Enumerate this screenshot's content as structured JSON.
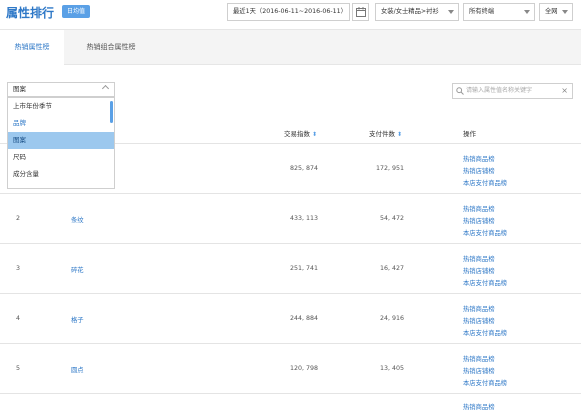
{
  "header": {
    "title": "属性排行",
    "badge": "日均值",
    "date_range": "最近1天（2016-06-11~2016-06-11）",
    "category": "女装/女士精品>衬衫",
    "terminal": "所有终端",
    "scope": "全网"
  },
  "tabs": [
    {
      "label": "热销属性榜",
      "active": true
    },
    {
      "label": "热销组合属性榜",
      "active": false
    }
  ],
  "filter": {
    "selected": "图案",
    "options": [
      "上市年份季节",
      "品牌",
      "图案",
      "尺码",
      "成分含量"
    ]
  },
  "search": {
    "placeholder": "请输入属性值名称关键字"
  },
  "table": {
    "headers": {
      "trade_index": "交易指数",
      "pay_count": "支付件数",
      "action": "操作"
    },
    "action_links": [
      "热销商品榜",
      "热销店铺榜",
      "本店支付商品榜"
    ],
    "rows": [
      {
        "rank": "",
        "name": "",
        "trade_index": "825, 874",
        "pay_count": "172, 951"
      },
      {
        "rank": "2",
        "name": "条纹",
        "trade_index": "433, 113",
        "pay_count": "54, 472"
      },
      {
        "rank": "3",
        "name": "碎花",
        "trade_index": "251, 741",
        "pay_count": "16, 427"
      },
      {
        "rank": "4",
        "name": "格子",
        "trade_index": "244, 884",
        "pay_count": "24, 916"
      },
      {
        "rank": "5",
        "name": "圆点",
        "trade_index": "120, 798",
        "pay_count": "13, 405"
      }
    ],
    "partial_row_action": "热销商品榜"
  },
  "colors": {
    "accent": "#2e78c7",
    "badge": "#5aa0e6",
    "selected_option": "#9cc8ee"
  }
}
